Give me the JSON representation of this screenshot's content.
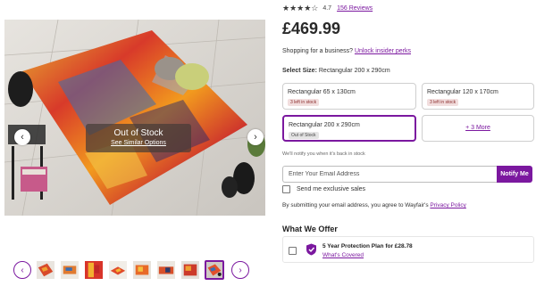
{
  "product": {
    "rating_stars": "★★★★☆",
    "rating_value": "4.7",
    "reviews_link": "156 Reviews",
    "price": "£469.99",
    "business_prefix": "Shopping for a business?",
    "business_link": "Unlock insider perks"
  },
  "hero": {
    "oos_title": "Out of Stock",
    "oos_link": "See Similar Options",
    "prev_arrow": "‹",
    "next_arrow": "›"
  },
  "thumbnails": {
    "prev_arrow": "‹",
    "next_arrow": "›",
    "count": 8,
    "selected_index": 7
  },
  "size": {
    "label": "Select Size:",
    "selected_value": "Rectangular 200 x 290cm",
    "options": [
      {
        "name": "Rectangular 65 x 130cm",
        "badge": "3 left in stock"
      },
      {
        "name": "Rectangular 120 x 170cm",
        "badge": "3 left in stock"
      },
      {
        "name": "Rectangular 200 x 290cm",
        "badge": "Out of Stock"
      }
    ],
    "more_link": "+ 3 More"
  },
  "notify": {
    "note": "We'll notify you when it's back in stock",
    "email_placeholder": "Enter Your Email Address",
    "button": "Notify Me",
    "exclusive_label": "Send me exclusive sales",
    "agree_prefix": "By submitting your email address, you agree to Wayfair's",
    "agree_link": "Privacy Policy"
  },
  "offer": {
    "title": "What We Offer",
    "plan": "5 Year Protection Plan for £28.78",
    "link": "What's Covered"
  },
  "colors": {
    "accent": "#7b189f"
  }
}
